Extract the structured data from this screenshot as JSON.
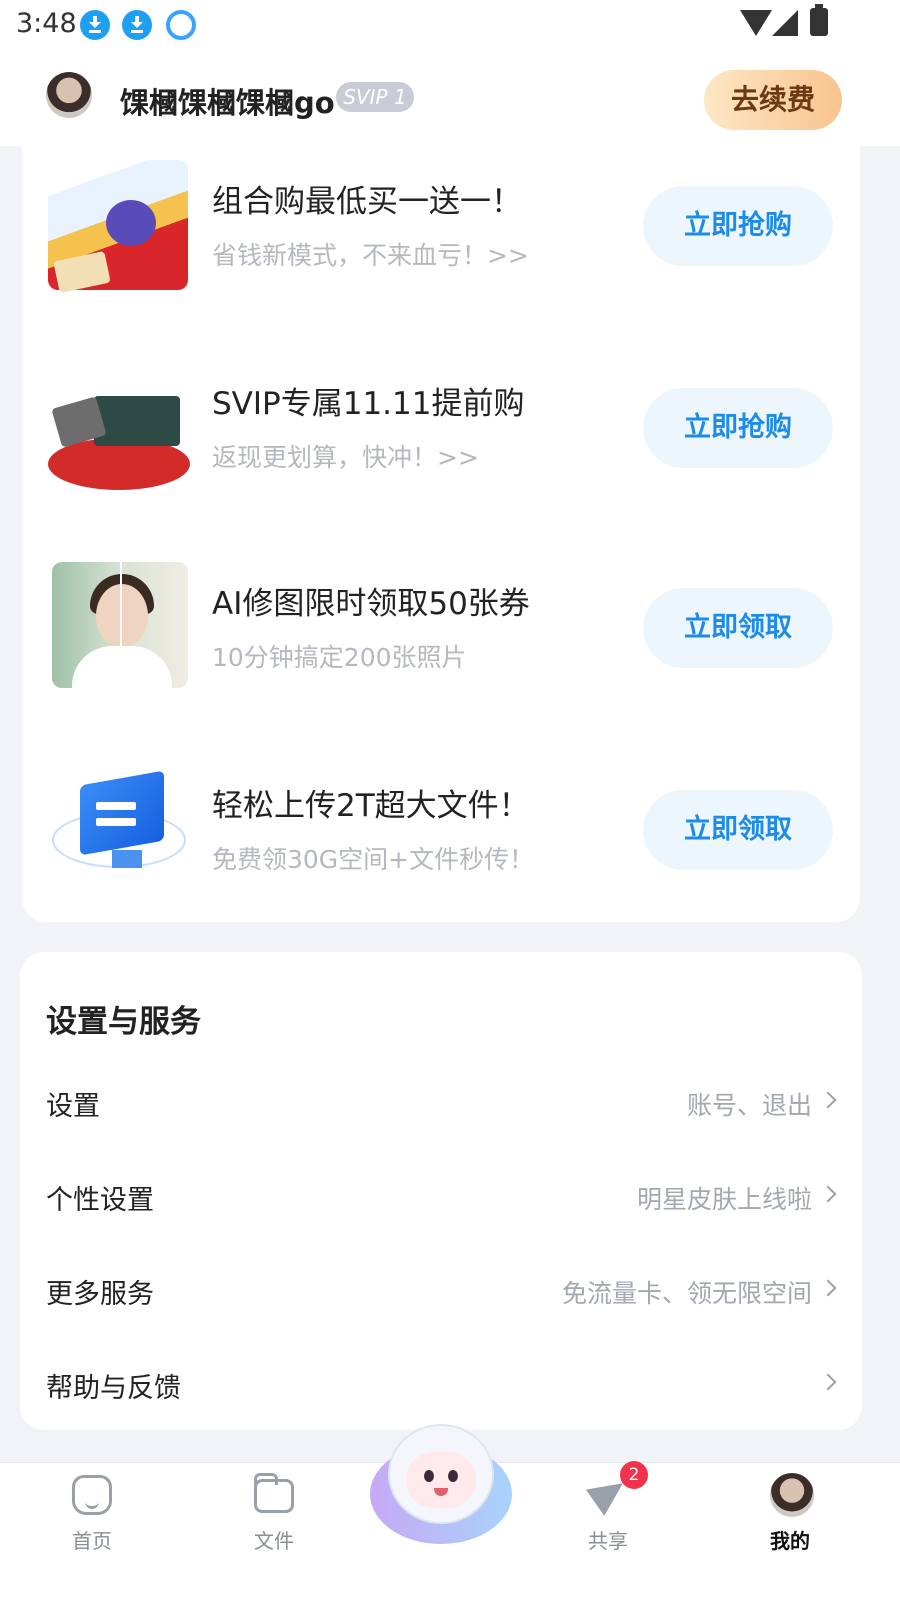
{
  "status_bar": {
    "time": "3:48",
    "icons": [
      "download-icon",
      "download-icon",
      "cloud-app-icon",
      "wifi-icon",
      "cellular-icon",
      "battery-icon"
    ]
  },
  "header": {
    "username": "馃槶馃槶馃槶go",
    "svip_label": "SVIP 1",
    "renew_label": "去续费"
  },
  "promos": [
    {
      "title": "组合购最低买一送一！",
      "subtitle": "省钱新模式，不来血亏！>>",
      "button": "立即抢购"
    },
    {
      "title": "SVIP专属11.11提前购",
      "subtitle": "返现更划算，快冲！>>",
      "button": "立即抢购"
    },
    {
      "title": "AI修图限时领取50张券",
      "subtitle": "10分钟搞定200张照片",
      "button": "立即领取"
    },
    {
      "title": "轻松上传2T超大文件！",
      "subtitle": "免费领30G空间+文件秒传！",
      "button": "立即领取"
    }
  ],
  "settings": {
    "title": "设置与服务",
    "rows": [
      {
        "label": "设置",
        "hint": "账号、退出"
      },
      {
        "label": "个性设置",
        "hint": "明星皮肤上线啦"
      },
      {
        "label": "更多服务",
        "hint": "免流量卡、领无限空间"
      },
      {
        "label": "帮助与反馈",
        "hint": ""
      }
    ]
  },
  "bottom_nav": {
    "items": [
      {
        "label": "首页",
        "icon": "home-icon"
      },
      {
        "label": "文件",
        "icon": "folder-icon"
      },
      {
        "label": "共享",
        "icon": "share-icon",
        "badge": "2"
      },
      {
        "label": "我的",
        "icon": "avatar",
        "active": true
      }
    ]
  },
  "colors": {
    "accent": "#1c8ce8",
    "button_bg": "#eef6fd",
    "renew_gradient_start": "#fde7c4",
    "renew_gradient_end": "#f9c48f",
    "badge": "#f2334b"
  }
}
